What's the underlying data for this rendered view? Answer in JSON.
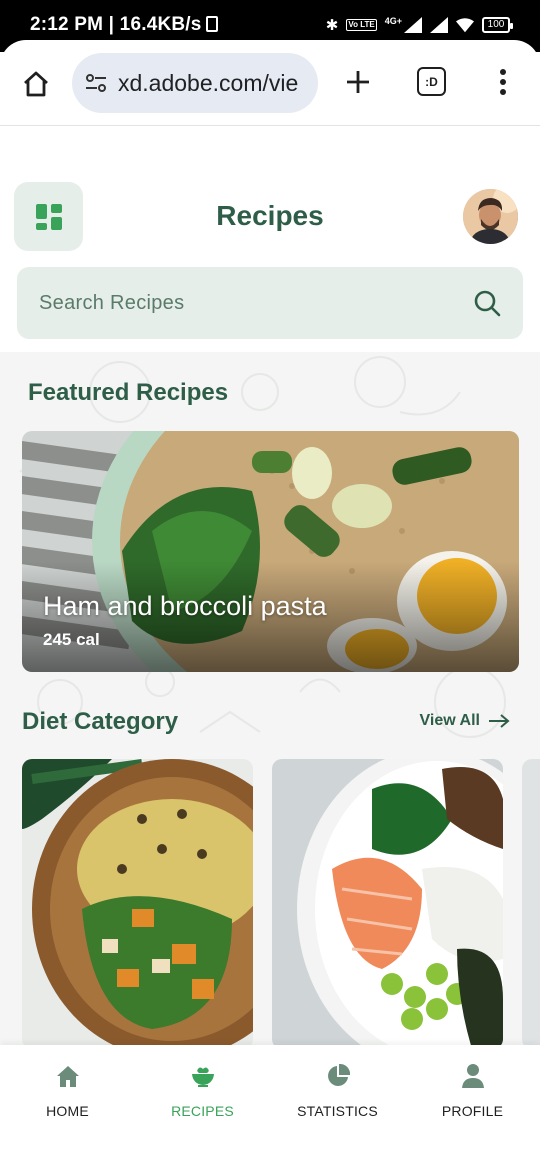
{
  "status_bar": {
    "time": "2:12 PM | 16.4KB/s",
    "network": "4G+",
    "volte": "Vo LTE",
    "battery": "100"
  },
  "browser": {
    "url": "xd.adobe.com/vie",
    "tab_count": ":D"
  },
  "header": {
    "title": "Recipes"
  },
  "search": {
    "placeholder": "Search Recipes"
  },
  "featured": {
    "section_title": "Featured Recipes",
    "recipe_name": "Ham and broccoli pasta",
    "calories": "245 cal"
  },
  "diet": {
    "section_title": "Diet Category",
    "view_all": "View All"
  },
  "bottom_nav": {
    "items": [
      {
        "label": "HOME",
        "icon": "home-icon"
      },
      {
        "label": "RECIPES",
        "icon": "bowl-icon"
      },
      {
        "label": "STATISTICS",
        "icon": "pie-chart-icon"
      },
      {
        "label": "PROFILE",
        "icon": "person-icon"
      }
    ],
    "active": "RECIPES"
  },
  "colors": {
    "primary": "#2e5e48",
    "accent": "#3aa35a",
    "surface": "#e6eee9"
  }
}
